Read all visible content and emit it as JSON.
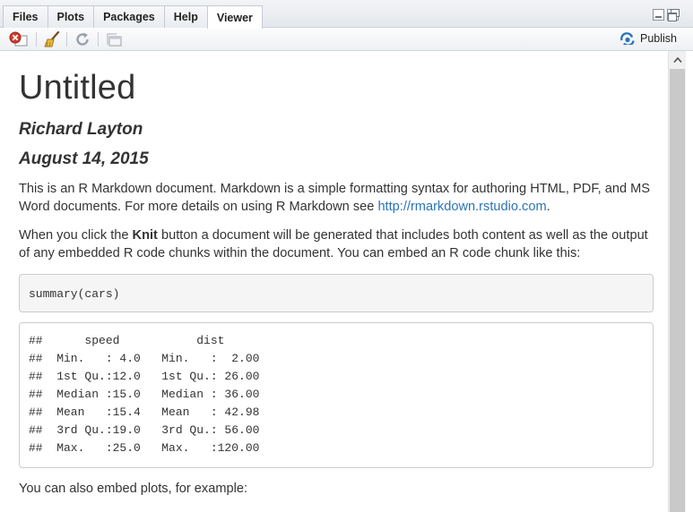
{
  "tabs": [
    {
      "label": "Files"
    },
    {
      "label": "Plots"
    },
    {
      "label": "Packages"
    },
    {
      "label": "Help"
    },
    {
      "label": "Viewer",
      "active": true
    }
  ],
  "toolbar": {
    "icons": [
      "stop-icon",
      "clear-broom-icon",
      "refresh-icon",
      "open-in-window-icon"
    ],
    "publish_label": "Publish",
    "accent": "#2a73b8"
  },
  "document": {
    "title": "Untitled",
    "author": "Richard Layton",
    "date": "August 14, 2015",
    "p1_text": "This is an R Markdown document. Markdown is a simple formatting syntax for authoring HTML, PDF, and MS Word documents. For more details on using R Markdown see ",
    "p1_link": "http://rmarkdown.rstudio.com",
    "p1_end": ".",
    "p2_before": "When you click the ",
    "p2_bold": "Knit",
    "p2_after": " button a document will be generated that includes both content as well as the output of any embedded R code chunks within the document. You can embed an R code chunk like this:",
    "code": "summary(cars)",
    "output_lines": [
      "##      speed           dist       ",
      "##  Min.   : 4.0   Min.   :  2.00  ",
      "##  1st Qu.:12.0   1st Qu.: 26.00  ",
      "##  Median :15.0   Median : 36.00  ",
      "##  Mean   :15.4   Mean   : 42.98  ",
      "##  3rd Qu.:19.0   3rd Qu.: 56.00  ",
      "##  Max.   :25.0   Max.   :120.00  "
    ],
    "p3_text": "You can also embed plots, for example:"
  }
}
